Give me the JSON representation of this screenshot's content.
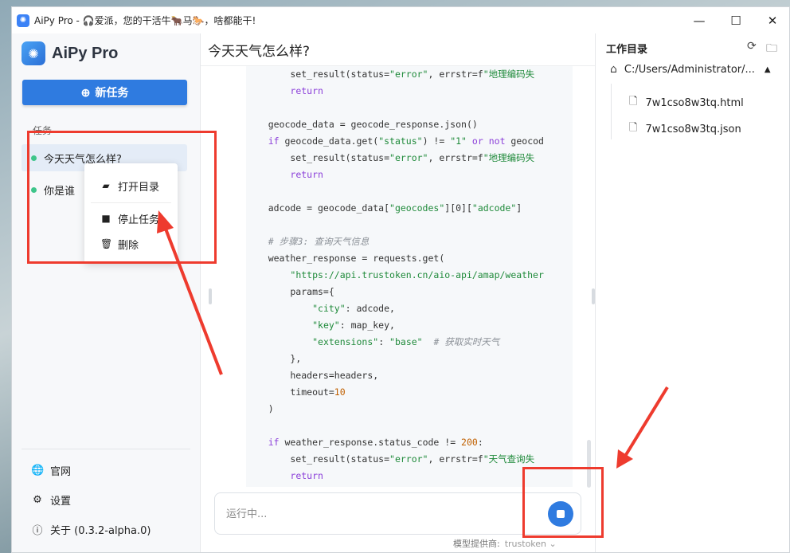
{
  "titlebar": {
    "title": "AiPy Pro - 🎧爱派，您的干活牛🐂马🐎，啥都能干!",
    "minimize": "—",
    "maximize": "☐",
    "close": "✕"
  },
  "sidebar": {
    "app_name": "AiPy Pro",
    "new_task_label": "新任务",
    "tasks_label": "任务",
    "tasks": [
      {
        "title": "今天天气怎么样?"
      },
      {
        "title": "你是谁"
      }
    ],
    "context_menu": {
      "open_dir": "打开目录",
      "stop_task": "停止任务",
      "delete": "删除"
    },
    "bottom": {
      "website": "官网",
      "settings": "设置",
      "about": "关于 (0.3.2-alpha.0)"
    }
  },
  "main": {
    "title": "今天天气怎么样?",
    "input_placeholder": "运行中...",
    "provider_label": "模型提供商:",
    "provider_value": "trustoken ⌄"
  },
  "code_lines": [
    [
      [
        "        set_result(status=",
        ""
      ],
      [
        "\"error\"",
        "str"
      ],
      [
        ", errstr=f",
        ""
      ],
      [
        "\"地理编码失",
        "str"
      ]
    ],
    [
      [
        "        ",
        ""
      ],
      [
        "return",
        "kw"
      ]
    ],
    [
      [
        "",
        ""
      ]
    ],
    [
      [
        "    geocode_data = geocode_response.json()",
        ""
      ]
    ],
    [
      [
        "    ",
        ""
      ],
      [
        "if",
        "kw"
      ],
      [
        " geocode_data.get(",
        ""
      ],
      [
        "\"status\"",
        "str"
      ],
      [
        ") != ",
        ""
      ],
      [
        "\"1\"",
        "str"
      ],
      [
        " ",
        ""
      ],
      [
        "or",
        "kw"
      ],
      [
        " ",
        ""
      ],
      [
        "not",
        "kw"
      ],
      [
        " geocod",
        ""
      ]
    ],
    [
      [
        "        set_result(status=",
        ""
      ],
      [
        "\"error\"",
        "str"
      ],
      [
        ", errstr=f",
        ""
      ],
      [
        "\"地理编码失",
        "str"
      ]
    ],
    [
      [
        "        ",
        ""
      ],
      [
        "return",
        "kw"
      ]
    ],
    [
      [
        "",
        ""
      ]
    ],
    [
      [
        "    adcode = geocode_data[",
        ""
      ],
      [
        "\"geocodes\"",
        "str"
      ],
      [
        "][0][",
        ""
      ],
      [
        "\"adcode\"",
        "str"
      ],
      [
        "]",
        ""
      ]
    ],
    [
      [
        "",
        ""
      ]
    ],
    [
      [
        "    ",
        ""
      ],
      [
        "# 步骤3: 查询天气信息",
        "cmt"
      ]
    ],
    [
      [
        "    weather_response = requests.get(",
        ""
      ]
    ],
    [
      [
        "        ",
        ""
      ],
      [
        "\"https://api.trustoken.cn/aio-api/amap/weather",
        "str"
      ]
    ],
    [
      [
        "        params={",
        ""
      ]
    ],
    [
      [
        "            ",
        ""
      ],
      [
        "\"city\"",
        "str"
      ],
      [
        ": adcode,",
        ""
      ]
    ],
    [
      [
        "            ",
        ""
      ],
      [
        "\"key\"",
        "str"
      ],
      [
        ": map_key,",
        ""
      ]
    ],
    [
      [
        "            ",
        ""
      ],
      [
        "\"extensions\"",
        "str"
      ],
      [
        ": ",
        ""
      ],
      [
        "\"base\"",
        "str"
      ],
      [
        "  ",
        ""
      ],
      [
        "# 获取实时天气",
        "cmt"
      ]
    ],
    [
      [
        "        },",
        ""
      ]
    ],
    [
      [
        "        headers=headers,",
        ""
      ]
    ],
    [
      [
        "        timeout=",
        ""
      ],
      [
        "10",
        "num"
      ]
    ],
    [
      [
        "    )",
        ""
      ]
    ],
    [
      [
        "",
        ""
      ]
    ],
    [
      [
        "    ",
        ""
      ],
      [
        "if",
        "kw"
      ],
      [
        " weather_response.status_code != ",
        ""
      ],
      [
        "200",
        "num"
      ],
      [
        ":",
        ""
      ]
    ],
    [
      [
        "        set_result(status=",
        ""
      ],
      [
        "\"error\"",
        "str"
      ],
      [
        ", errstr=f",
        ""
      ],
      [
        "\"天气查询失",
        "str"
      ]
    ],
    [
      [
        "        ",
        ""
      ],
      [
        "return",
        "kw"
      ]
    ]
  ],
  "rightpanel": {
    "title": "工作目录",
    "dir_path": "C:/Users/Administrator/...",
    "files": [
      {
        "name": "7w1cso8w3tq.html"
      },
      {
        "name": "7w1cso8w3tq.json"
      }
    ]
  },
  "colors": {
    "accent": "#2f7be0",
    "status_dot": "#3ec58a",
    "annotation": "#ee3b2e"
  }
}
